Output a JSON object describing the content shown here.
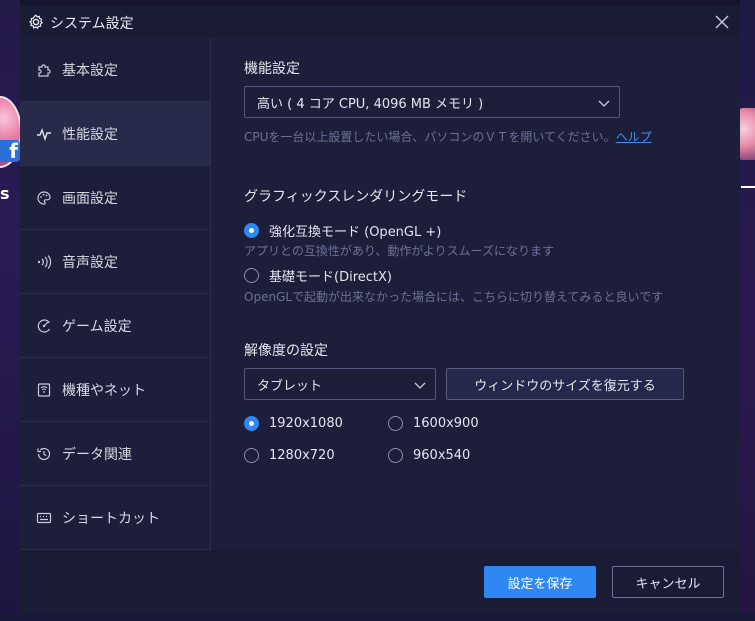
{
  "window": {
    "title": "システム設定"
  },
  "sidebar": {
    "items": [
      {
        "label": "基本設定",
        "icon": "puzzle-icon"
      },
      {
        "label": "性能設定",
        "icon": "pulse-icon"
      },
      {
        "label": "画面設定",
        "icon": "palette-icon"
      },
      {
        "label": "音声設定",
        "icon": "sound-icon"
      },
      {
        "label": "ゲーム設定",
        "icon": "game-icon"
      },
      {
        "label": "機種やネット",
        "icon": "device-icon"
      },
      {
        "label": "データ関連",
        "icon": "history-icon"
      },
      {
        "label": "ショートカット",
        "icon": "keyboard-icon"
      }
    ],
    "active_index": 1
  },
  "performance": {
    "section_label": "機能設定",
    "selected_value": "高い ( 4 コア CPU, 4096 MB メモリ )",
    "hint_text": "CPUを一台以上設置したい場合、パソコンのＶＴを開いてください。",
    "help_link": "ヘルプ"
  },
  "graphics": {
    "section_label": "グラフィックスレンダリングモード",
    "options": [
      {
        "label": "強化互換モード (OpenGL +)",
        "selected": true,
        "description": "アプリとの互換性があり、動作がよりスムーズになります"
      },
      {
        "label": "基礎モード(DirectX)",
        "selected": false,
        "description": "OpenGLで起動が出来なかった場合には、こちらに切り替えてみると良いです"
      }
    ]
  },
  "resolution": {
    "section_label": "解像度の設定",
    "mode_selected": "タブレット",
    "restore_button": "ウィンドウのサイズを復元する",
    "options": [
      {
        "label": "1920x1080",
        "selected": true
      },
      {
        "label": "1600x900",
        "selected": false
      },
      {
        "label": "1280x720",
        "selected": false
      },
      {
        "label": "960x540",
        "selected": false
      }
    ]
  },
  "footer": {
    "save_label": "設定を保存",
    "cancel_label": "キャンセル"
  },
  "colors": {
    "accent": "#2e87f2",
    "background": "#1d1f3a",
    "sidebar_active": "#272a48",
    "hint_text": "#6d7096",
    "link": "#3e8ef6"
  }
}
